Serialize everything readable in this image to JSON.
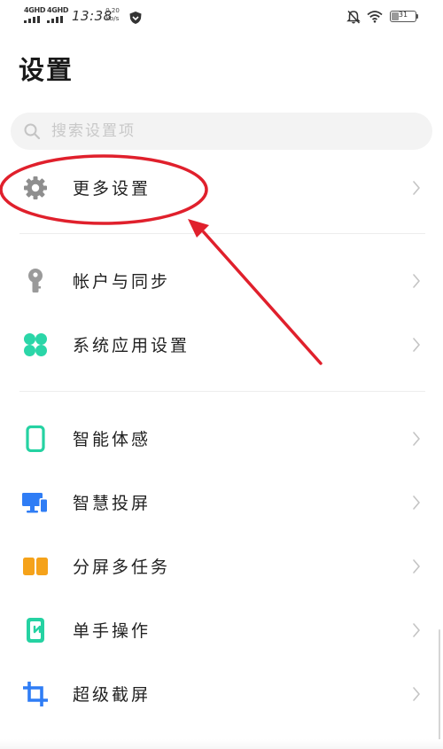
{
  "status_bar": {
    "signal_1_label": "4GHD",
    "signal_2_label": "4GHD",
    "time": "13:38",
    "speed_value": "0.20",
    "speed_unit": "kb/s",
    "battery_level": "31",
    "icons": [
      "signal-icon",
      "signal-icon",
      "shield-icon",
      "bell-off-icon",
      "wifi-icon",
      "battery-icon"
    ]
  },
  "page": {
    "title": "设置"
  },
  "search": {
    "placeholder": "搜索设置项",
    "value": ""
  },
  "settings": [
    {
      "label": "更多设置",
      "icon": "gear-icon",
      "color": "#8e8e8e"
    },
    {
      "label": "帐户与同步",
      "icon": "key-icon",
      "color": "#9a9a9a"
    },
    {
      "label": "系统应用设置",
      "icon": "apps-icon",
      "color": "#2bd6a8"
    },
    {
      "label": "智能体感",
      "icon": "phone-outline-icon",
      "color": "#25d2a2"
    },
    {
      "label": "智慧投屏",
      "icon": "screen-cast-icon",
      "color": "#2f7df5"
    },
    {
      "label": "分屏多任务",
      "icon": "split-screen-icon",
      "color": "#f5a21a"
    },
    {
      "label": "单手操作",
      "icon": "one-hand-icon",
      "color": "#25d2a2"
    },
    {
      "label": "超级截屏",
      "icon": "crop-icon",
      "color": "#2f7df5"
    }
  ],
  "annotation": {
    "color": "#e0202c",
    "target": "更多设置"
  }
}
